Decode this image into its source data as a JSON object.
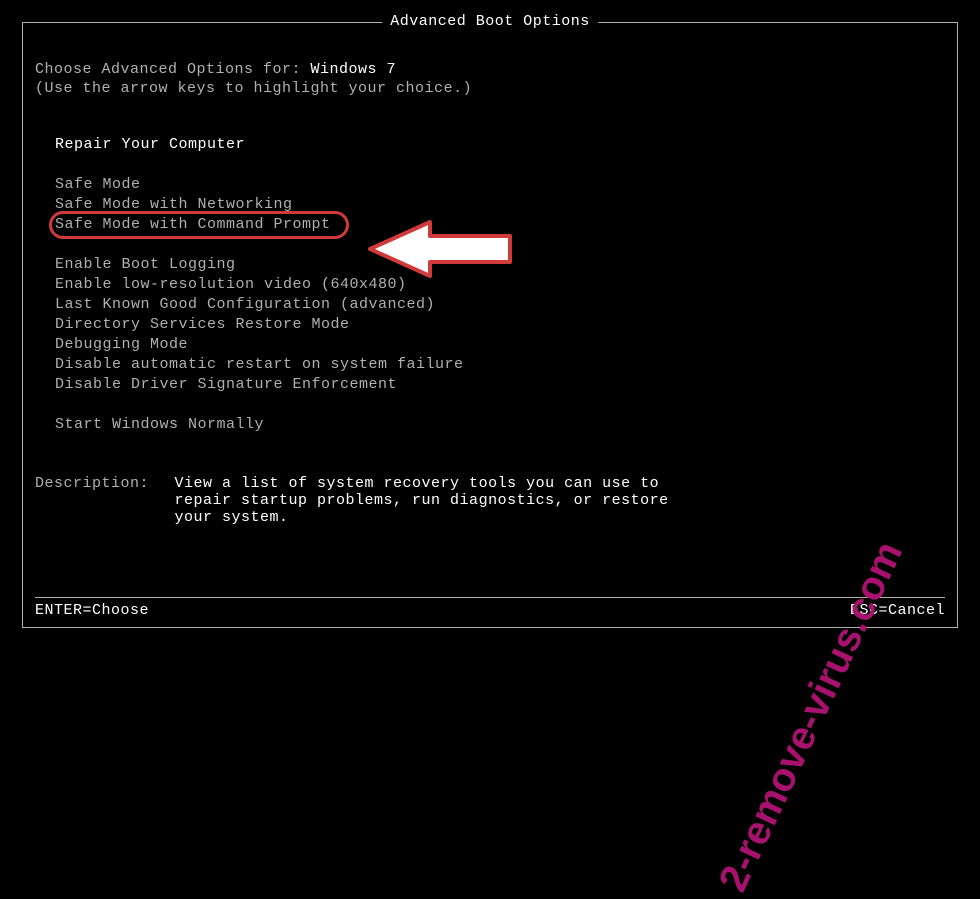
{
  "title": "Advanced Boot Options",
  "instructions": {
    "prefix": "Choose Advanced Options for: ",
    "os": "Windows 7",
    "hint": "(Use the arrow keys to highlight your choice.)"
  },
  "menu": {
    "group1": [
      "Repair Your Computer"
    ],
    "group2": [
      "Safe Mode",
      "Safe Mode with Networking",
      "Safe Mode with Command Prompt"
    ],
    "group3": [
      "Enable Boot Logging",
      "Enable low-resolution video (640x480)",
      "Last Known Good Configuration (advanced)",
      "Directory Services Restore Mode",
      "Debugging Mode",
      "Disable automatic restart on system failure",
      "Disable Driver Signature Enforcement"
    ],
    "group4": [
      "Start Windows Normally"
    ],
    "highlighted_index_in_group2": 2
  },
  "description": {
    "label": "Description:",
    "text": "View a list of system recovery tools you can use to repair startup problems, run diagnostics, or restore your system."
  },
  "footer": {
    "left": "ENTER=Choose",
    "right": "ESC=Cancel"
  },
  "watermark": "2-remove-virus.com",
  "annotation": {
    "highlight_color": "#d13a3a",
    "arrow_color_fill": "#ffffff",
    "arrow_color_stroke": "#d13a3a"
  }
}
